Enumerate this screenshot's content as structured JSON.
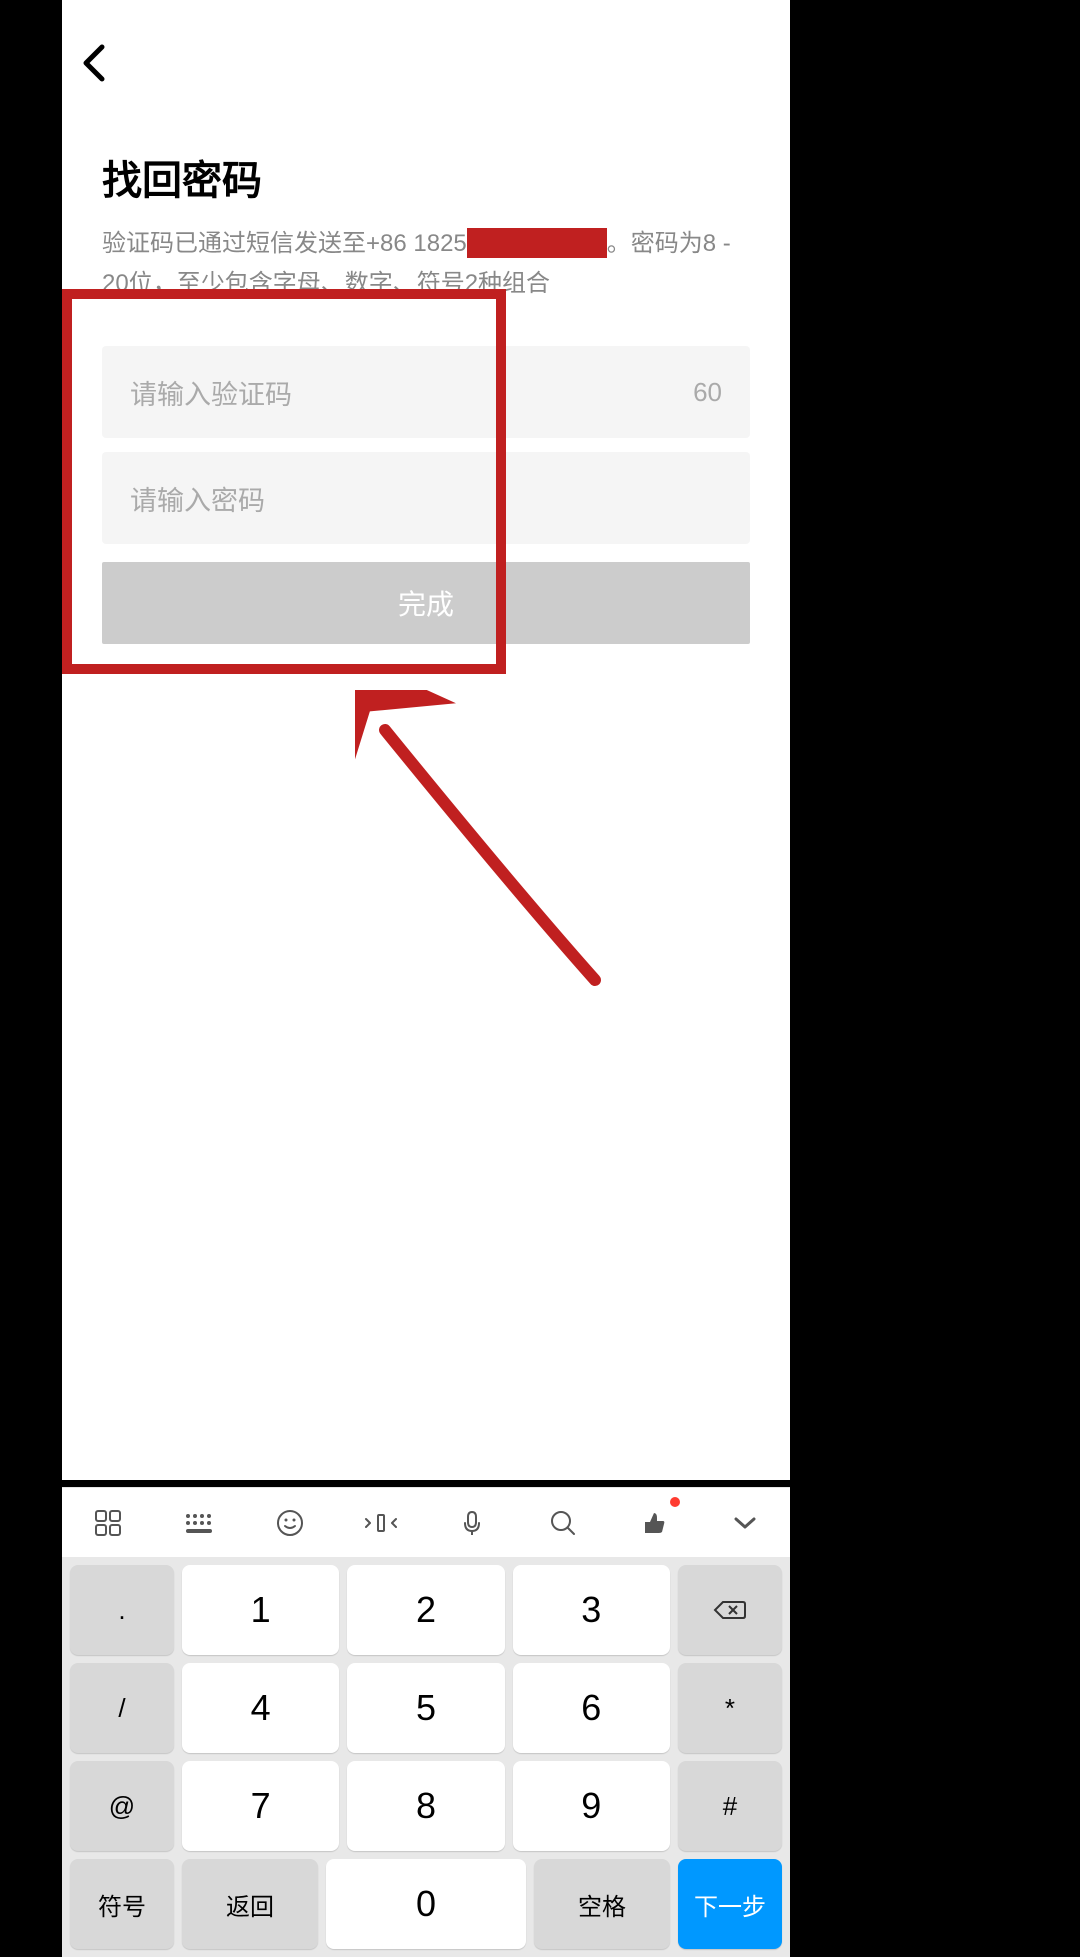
{
  "header": {
    "title": "找回密码"
  },
  "subtitle": {
    "prefix": "验证码已通过短信发送至+86 1825",
    "suffix": "。密码为8 - 20位，至少包含字母、数字、符号2种组合"
  },
  "form": {
    "code_placeholder": "请输入验证码",
    "countdown": "60",
    "password_placeholder": "请输入密码",
    "submit_label": "完成"
  },
  "keyboard": {
    "toolbar": {
      "apps": "apps",
      "keyboard": "keyboard",
      "emoji": "emoji",
      "cursor": "cursor",
      "voice": "voice",
      "search": "search",
      "thumbs": "thumbs",
      "collapse": "collapse"
    },
    "side_left": [
      ".",
      "/",
      "@",
      "-"
    ],
    "digits": [
      "1",
      "2",
      "3",
      "4",
      "5",
      "6",
      "7",
      "8",
      "9",
      "0"
    ],
    "side_right_top": "backspace",
    "side_right": [
      "*",
      "#"
    ],
    "bottom": {
      "symbols": "符号",
      "back": "返回",
      "space": "空格",
      "next": "下一步"
    }
  }
}
